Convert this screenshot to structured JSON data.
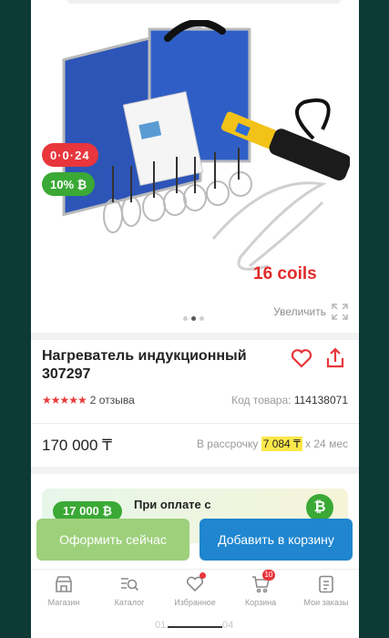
{
  "badges": {
    "installment": "0·0·24",
    "bonus": "10% ₿"
  },
  "gallery": {
    "image_caption": "16 coils",
    "zoom_label": "Увеличить",
    "dots": 3,
    "active_dot": 1
  },
  "product": {
    "title": "Нагреватель индукционный 307297",
    "rating_stars": 5,
    "reviews": "2 отзыва",
    "sku_label": "Код товара:",
    "sku": "114138071",
    "price": "170 000 ₸",
    "installment_prefix": "В рассрочку",
    "installment_amount": "7 084 ₸",
    "installment_suffix": "x 24 мес"
  },
  "promo": {
    "pill": "17 000 ₿",
    "text": "При оплате с"
  },
  "actions": {
    "buy_now": "Оформить сейчас",
    "add_to_cart": "Добавить в корзину"
  },
  "nav": {
    "items": [
      {
        "label": "Магазин",
        "icon": "store-icon"
      },
      {
        "label": "Каталог",
        "icon": "catalog-search-icon"
      },
      {
        "label": "Избранное",
        "icon": "heart-icon"
      },
      {
        "label": "Корзина",
        "icon": "cart-icon",
        "badge": "10"
      },
      {
        "label": "Мои заказы",
        "icon": "orders-icon"
      }
    ]
  },
  "home_indicator": {
    "left": "01",
    "right": "04"
  },
  "colors": {
    "accent_red": "#e8363c",
    "accent_green": "#3aa935",
    "cart_blue": "#1f86cf",
    "buy_green": "#9ed07c",
    "highlight_yellow": "#fbe84a"
  }
}
